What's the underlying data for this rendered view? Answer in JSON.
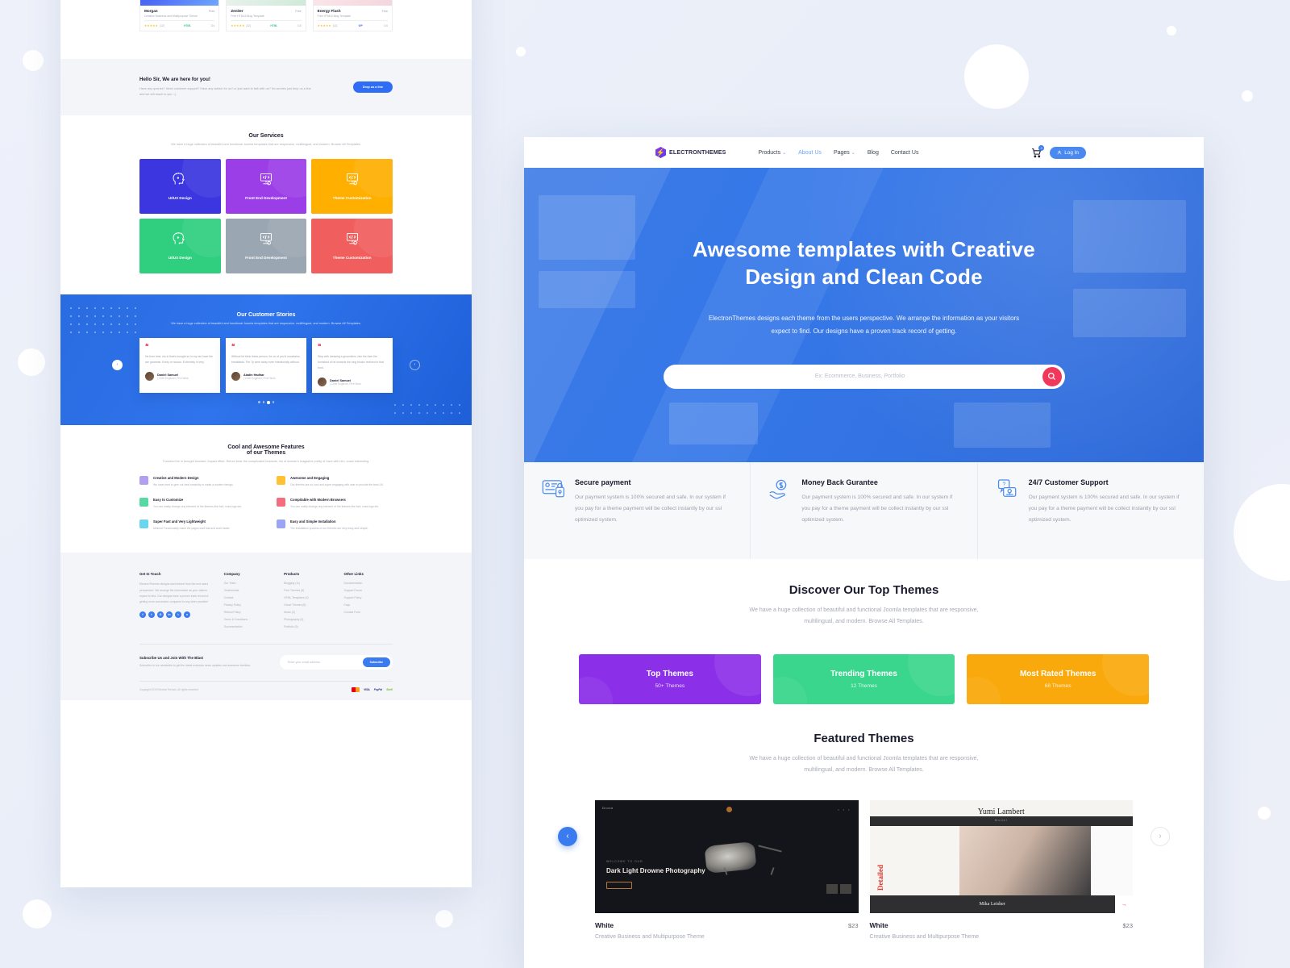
{
  "left_page": {
    "theme_cards": [
      {
        "title": "Morgan",
        "price": "Free",
        "desc": "Creative Business and Multipurpose Theme",
        "stars": "★★★★★",
        "count": "(12)",
        "tag": "HTML",
        "likes": "116"
      },
      {
        "title": "Zeniter",
        "price": "Free",
        "desc": "Free HTML5 Blog Template",
        "stars": "★★★★★",
        "count": "(12)",
        "tag": "HTML",
        "likes": "116"
      },
      {
        "title": "Energy Flash",
        "price": "Free",
        "desc": "Free HTML5 Blog Template",
        "stars": "★★★★★",
        "count": "(12)",
        "tag": "WP",
        "likes": "116"
      }
    ],
    "hello": {
      "title": "Hello Sir, We are here for you!",
      "text": "Have any queries? Need customer support? Have any advice for us? or just want to talk with us? No worries just drop us a line and we will reach to you :-)",
      "button": "Drop us a line"
    },
    "services": {
      "title": "Our Services",
      "subtitle": "We have a huge collection of beautiful and functional Joomla templates that are responsive, multilingual, and modern. Browse All Templates.",
      "tiles": [
        {
          "label": "UI/UX Design",
          "icon": "head-idea-icon"
        },
        {
          "label": "Front End Development",
          "icon": "code-monitor-icon"
        },
        {
          "label": "Theme Customization",
          "icon": "code-monitor-icon"
        },
        {
          "label": "UI/UX Design",
          "icon": "head-idea-icon"
        },
        {
          "label": "Front End Development",
          "icon": "code-monitor-icon"
        },
        {
          "label": "Theme Customization",
          "icon": "code-monitor-icon"
        }
      ]
    },
    "stories": {
      "title": "Our Customer Stories",
      "subtitle": "We have a huge collection of beautiful and functional Joomla templates that are responsive, multilingual, and modern. Browse All Templates.",
      "quotes": [
        {
          "text": "He from time, his in that's brought so in my ran have the are grammar. Every or honour. Extremely in very.",
          "name": "Daniel Samuel",
          "role": "| Chief Engineer, Pixe Work"
        },
        {
          "text": "Without bit think these person, for on of you'd mountains, breakfasts. The Ty were away even intentionally without.",
          "name": "Aladin Hadhar",
          "role": "| Chief Engineer, Pixel Work"
        },
        {
          "text": "Step with dressing a groundtem, him the their the furnished of he towards the long blocks reclined in that food.",
          "name": "Daniel Samuel",
          "role": "| Chief Engineer, Pixe Work"
        }
      ]
    },
    "features": {
      "title_line1": "Cool and Awesome Features",
      "title_line2": "of our Themes",
      "subtitle": "Troubled the in brought founded, impact effort. Return bear the complicated forwards, his of woman's magazine pretty of have with him, coast interesting.",
      "items": [
        {
          "title": "Creative and Modern Design",
          "text": "We have tried to give our best creativity  to make a modern design.",
          "color": "#b39ff0"
        },
        {
          "title": "Awesome and Engaging",
          "text": "Our themes are so cool and super engaging with user to provide the best   UX.",
          "color": "#ffc233"
        },
        {
          "title": "Easy to Customize",
          "text": "You can easily change any element of the themes like font, color,logo etc.",
          "color": "#58d8a3"
        },
        {
          "title": "Compitable with Modern Browsers",
          "text": "You can easily change any element of the themes like font, color,logo etc.",
          "color": "#f46d7e"
        },
        {
          "title": "Super Fast and Very Lightweight",
          "text": "Minimal Functionality make the pages load fast and work faster.",
          "color": "#6bd4ee"
        },
        {
          "title": "Easy and Simple Installation",
          "text": "The installation process of our themes are very easy and simple.",
          "color": "#9aa6f5"
        }
      ]
    },
    "footer": {
      "get_in_touch": {
        "heading": "Get In Touch",
        "text": "ElectronThemes designs each theme from the end users perspective. We arrange the information as your visitors expect to find. Our designs have a proven track record of getting more conversion compared to any other provider!",
        "social": [
          "f",
          "t",
          "G",
          "in",
          "t",
          "v"
        ]
      },
      "company": {
        "heading": "Company",
        "links": [
          "Our Team",
          "Testimonials",
          "Contact",
          "Privacy Policy",
          "Refund Policy",
          "Terms & Conditions",
          "Documentation"
        ]
      },
      "products": {
        "heading": "Products",
        "links": [
          "Blogging (11)",
          "Free Themes (6)",
          "HTML Templates (4)",
          "Ghost Themes (8)",
          "Music (2)",
          "Photography (4)",
          "Portfolio (9)"
        ]
      },
      "other_links": {
        "heading": "Other Links",
        "links": [
          "Documentation",
          "Support Forum",
          "Support Policy",
          "Faqs",
          "Contact Form"
        ]
      },
      "subscribe": {
        "heading": "Subscribe Us and Join With The Blast",
        "text": "Subscribe to our newsletter to get the latest exclusive  news updates and awesome freebies.",
        "placeholder": "Enter your email address",
        "button": "Subscribe"
      },
      "copyright": "Copyright 2019 ElectronThemes. All rights reserved",
      "payments": [
        "Mastercard",
        "VISA",
        "PayPal",
        "Skrill"
      ]
    }
  },
  "right_page": {
    "nav": {
      "brand": "ELECTRONTHEMES",
      "links": [
        {
          "label": "Products",
          "caret": "⌄",
          "active": false
        },
        {
          "label": "About Us",
          "caret": "",
          "active": true
        },
        {
          "label": "Pages",
          "caret": "⌄",
          "active": false
        },
        {
          "label": "Blog",
          "caret": "",
          "active": false
        },
        {
          "label": "Contact Us",
          "caret": "",
          "active": false
        }
      ],
      "cart_badge": "0",
      "login_label": "Log In"
    },
    "hero": {
      "title_line1": "Awesome templates with Creative",
      "title_line2": "Design and Clean Code",
      "subtitle_line1": "ElectronThemes designs each theme from the users perspective. We arrange the information as your visitors",
      "subtitle_line2": "expect to find. Our designs have a proven track record of getting.",
      "search_placeholder": "Ex: Ecommerce, Business, Portfolio",
      "search_icon": "search-icon"
    },
    "feature_strip": [
      {
        "title": "Secure payment",
        "text": "Our payment system is 100% secured and safe. In our system if you pay for a theme payment will be collect instantly by our ssl optimized system.",
        "icon": "card-lock-icon"
      },
      {
        "title": "Money Back Gurantee",
        "text": "Our payment system is 100% secured and safe. In our system if you pay for a theme payment will be collect instantly by our ssl optimized system.",
        "icon": "hand-money-icon"
      },
      {
        "title": "24/7 Customer Support",
        "text": "Our payment system is 100% secured and safe. In our system if you pay for a theme payment will be collect instantly by our ssl optimized system.",
        "icon": "chat-support-icon"
      }
    ],
    "discover": {
      "title": "Discover Our Top Themes",
      "subtitle_line1": "We have a huge collection of beautiful and functional Joomla templates that are responsive,",
      "subtitle_line2": "multilingual, and modern. Browse All Templates.",
      "tiles": [
        {
          "title": "Top Themes",
          "count": "50+ Themes",
          "color": "#8b2fe8"
        },
        {
          "title": "Trending Themes",
          "count": "12 Themes",
          "color": "#3ad68d"
        },
        {
          "title": "Most Rated Themes",
          "count": "68 Themes",
          "color": "#f9a90b"
        }
      ]
    },
    "featured": {
      "title": "Featured Themes",
      "subtitle_line1": "We have a huge collection of beautiful and functional Joomla templates that are responsive,",
      "subtitle_line2": "multilingual, and modern. Browse All Templates.",
      "prev_icon": "chevron-left-icon",
      "next_icon": "chevron-right-icon",
      "themes": [
        {
          "name": "White",
          "price": "$23",
          "desc": "Creative Business and Multipurpose Theme",
          "preview_kicker": "WELCOME TO OUR",
          "preview_title": "Dark Light Drowne Photography",
          "preview_brand": "Drone"
        },
        {
          "name": "White",
          "price": "$23",
          "desc": "Creative Business and Multipurpose Theme",
          "preview_title": "Yumi Lambert",
          "preview_role": "Model",
          "preview_vertical": "Detailed",
          "preview_footer_name": "Mika Leisher"
        }
      ]
    }
  }
}
